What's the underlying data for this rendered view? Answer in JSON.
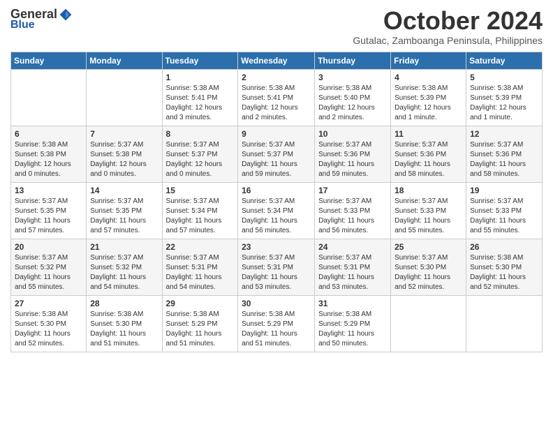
{
  "header": {
    "logo_general": "General",
    "logo_blue": "Blue",
    "month_title": "October 2024",
    "location": "Gutalac, Zamboanga Peninsula, Philippines"
  },
  "weekdays": [
    "Sunday",
    "Monday",
    "Tuesday",
    "Wednesday",
    "Thursday",
    "Friday",
    "Saturday"
  ],
  "weeks": [
    [
      {
        "day": "",
        "info": ""
      },
      {
        "day": "",
        "info": ""
      },
      {
        "day": "1",
        "info": "Sunrise: 5:38 AM\nSunset: 5:41 PM\nDaylight: 12 hours\nand 3 minutes."
      },
      {
        "day": "2",
        "info": "Sunrise: 5:38 AM\nSunset: 5:41 PM\nDaylight: 12 hours\nand 2 minutes."
      },
      {
        "day": "3",
        "info": "Sunrise: 5:38 AM\nSunset: 5:40 PM\nDaylight: 12 hours\nand 2 minutes."
      },
      {
        "day": "4",
        "info": "Sunrise: 5:38 AM\nSunset: 5:39 PM\nDaylight: 12 hours\nand 1 minute."
      },
      {
        "day": "5",
        "info": "Sunrise: 5:38 AM\nSunset: 5:39 PM\nDaylight: 12 hours\nand 1 minute."
      }
    ],
    [
      {
        "day": "6",
        "info": "Sunrise: 5:38 AM\nSunset: 5:38 PM\nDaylight: 12 hours\nand 0 minutes."
      },
      {
        "day": "7",
        "info": "Sunrise: 5:37 AM\nSunset: 5:38 PM\nDaylight: 12 hours\nand 0 minutes."
      },
      {
        "day": "8",
        "info": "Sunrise: 5:37 AM\nSunset: 5:37 PM\nDaylight: 12 hours\nand 0 minutes."
      },
      {
        "day": "9",
        "info": "Sunrise: 5:37 AM\nSunset: 5:37 PM\nDaylight: 11 hours\nand 59 minutes."
      },
      {
        "day": "10",
        "info": "Sunrise: 5:37 AM\nSunset: 5:36 PM\nDaylight: 11 hours\nand 59 minutes."
      },
      {
        "day": "11",
        "info": "Sunrise: 5:37 AM\nSunset: 5:36 PM\nDaylight: 11 hours\nand 58 minutes."
      },
      {
        "day": "12",
        "info": "Sunrise: 5:37 AM\nSunset: 5:36 PM\nDaylight: 11 hours\nand 58 minutes."
      }
    ],
    [
      {
        "day": "13",
        "info": "Sunrise: 5:37 AM\nSunset: 5:35 PM\nDaylight: 11 hours\nand 57 minutes."
      },
      {
        "day": "14",
        "info": "Sunrise: 5:37 AM\nSunset: 5:35 PM\nDaylight: 11 hours\nand 57 minutes."
      },
      {
        "day": "15",
        "info": "Sunrise: 5:37 AM\nSunset: 5:34 PM\nDaylight: 11 hours\nand 57 minutes."
      },
      {
        "day": "16",
        "info": "Sunrise: 5:37 AM\nSunset: 5:34 PM\nDaylight: 11 hours\nand 56 minutes."
      },
      {
        "day": "17",
        "info": "Sunrise: 5:37 AM\nSunset: 5:33 PM\nDaylight: 11 hours\nand 56 minutes."
      },
      {
        "day": "18",
        "info": "Sunrise: 5:37 AM\nSunset: 5:33 PM\nDaylight: 11 hours\nand 55 minutes."
      },
      {
        "day": "19",
        "info": "Sunrise: 5:37 AM\nSunset: 5:33 PM\nDaylight: 11 hours\nand 55 minutes."
      }
    ],
    [
      {
        "day": "20",
        "info": "Sunrise: 5:37 AM\nSunset: 5:32 PM\nDaylight: 11 hours\nand 55 minutes."
      },
      {
        "day": "21",
        "info": "Sunrise: 5:37 AM\nSunset: 5:32 PM\nDaylight: 11 hours\nand 54 minutes."
      },
      {
        "day": "22",
        "info": "Sunrise: 5:37 AM\nSunset: 5:31 PM\nDaylight: 11 hours\nand 54 minutes."
      },
      {
        "day": "23",
        "info": "Sunrise: 5:37 AM\nSunset: 5:31 PM\nDaylight: 11 hours\nand 53 minutes."
      },
      {
        "day": "24",
        "info": "Sunrise: 5:37 AM\nSunset: 5:31 PM\nDaylight: 11 hours\nand 53 minutes."
      },
      {
        "day": "25",
        "info": "Sunrise: 5:37 AM\nSunset: 5:30 PM\nDaylight: 11 hours\nand 52 minutes."
      },
      {
        "day": "26",
        "info": "Sunrise: 5:38 AM\nSunset: 5:30 PM\nDaylight: 11 hours\nand 52 minutes."
      }
    ],
    [
      {
        "day": "27",
        "info": "Sunrise: 5:38 AM\nSunset: 5:30 PM\nDaylight: 11 hours\nand 52 minutes."
      },
      {
        "day": "28",
        "info": "Sunrise: 5:38 AM\nSunset: 5:30 PM\nDaylight: 11 hours\nand 51 minutes."
      },
      {
        "day": "29",
        "info": "Sunrise: 5:38 AM\nSunset: 5:29 PM\nDaylight: 11 hours\nand 51 minutes."
      },
      {
        "day": "30",
        "info": "Sunrise: 5:38 AM\nSunset: 5:29 PM\nDaylight: 11 hours\nand 51 minutes."
      },
      {
        "day": "31",
        "info": "Sunrise: 5:38 AM\nSunset: 5:29 PM\nDaylight: 11 hours\nand 50 minutes."
      },
      {
        "day": "",
        "info": ""
      },
      {
        "day": "",
        "info": ""
      }
    ]
  ]
}
